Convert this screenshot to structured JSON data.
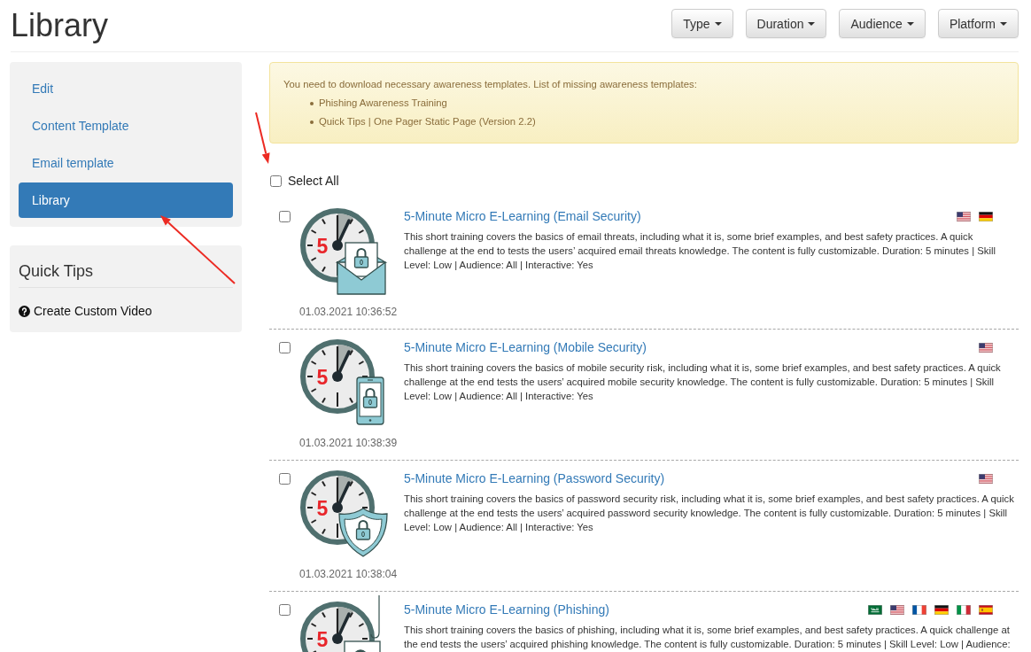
{
  "page": {
    "title": "Library"
  },
  "filters": [
    {
      "label": "Type"
    },
    {
      "label": "Duration"
    },
    {
      "label": "Audience"
    },
    {
      "label": "Platform"
    }
  ],
  "sidebar": {
    "items": [
      {
        "label": "Edit",
        "selected": false
      },
      {
        "label": "Content Template",
        "selected": false
      },
      {
        "label": "Email template",
        "selected": false
      },
      {
        "label": "Library",
        "selected": true
      }
    ]
  },
  "quick_tips": {
    "title": "Quick Tips",
    "links": [
      {
        "label": "Create Custom Video"
      }
    ]
  },
  "alert": {
    "message": "You need to download necessary awareness templates. List of missing awareness templates:",
    "items": [
      "Phishing Awareness Training",
      "Quick Tips | One Pager Static Page (Version 2.2)"
    ]
  },
  "select_all": {
    "label": "Select All",
    "checked": false
  },
  "library_items": [
    {
      "checked": false,
      "thumbnail": {
        "kind": "email",
        "number": "5"
      },
      "date": "01.03.2021 10:36:52",
      "title": "5-Minute Micro E-Learning (Email Security)",
      "description": "This short training covers the basics of email threats, including what it is, some brief examples, and best safety practices. A quick challenge at the end to tests the users’ acquired email threats knowledge. The content is fully customizable. Duration: 5 minutes | Skill Level: Low | Audience: All | Interactive: Yes",
      "flags": [
        {
          "kind": "us"
        },
        {
          "kind": "de"
        }
      ]
    },
    {
      "checked": false,
      "thumbnail": {
        "kind": "mobile",
        "number": "5"
      },
      "date": "01.03.2021 10:38:39",
      "title": "5-Minute Micro E-Learning (Mobile Security)",
      "description": "This short training covers the basics of mobile security risk, including what it is, some brief examples, and best safety practices. A quick challenge at the end tests the users’ acquired mobile security knowledge. The content is fully customizable. Duration: 5 minutes | Skill Level: Low | Audience: All | Interactive: Yes",
      "flags": [
        {
          "kind": "us"
        }
      ]
    },
    {
      "checked": false,
      "thumbnail": {
        "kind": "password",
        "number": "5"
      },
      "date": "01.03.2021 10:38:04",
      "title": "5-Minute Micro E-Learning (Password Security)",
      "description": "This short training covers the basics of password security risk, including what it is, some brief examples, and best safety practices. A quick challenge at the end tests the users’ acquired password security knowledge. The content is fully customizable. Duration: 5 minutes | Skill Level: Low | Audience: All | Interactive: Yes",
      "flags": [
        {
          "kind": "us"
        }
      ]
    },
    {
      "checked": false,
      "thumbnail": {
        "kind": "phishing",
        "number": "5"
      },
      "title": "5-Minute Micro E-Learning (Phishing)",
      "description": "This short training covers the basics of phishing, including what it is, some brief examples, and best safety practices. A quick challenge at the end tests the users’ acquired phishing knowledge. The content is fully customizable. Duration: 5 minutes | Skill Level: Low | Audience:",
      "flags": [
        {
          "kind": "sa"
        },
        {
          "kind": "us"
        },
        {
          "kind": "fr"
        },
        {
          "kind": "de"
        },
        {
          "kind": "it"
        },
        {
          "kind": "es"
        }
      ]
    }
  ]
}
